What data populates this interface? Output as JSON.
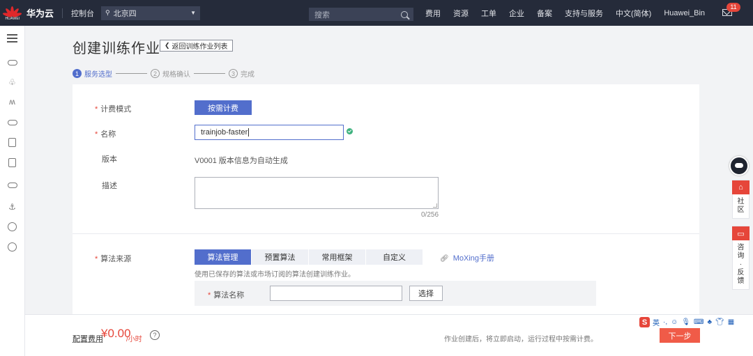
{
  "topbar": {
    "logo_caption": "HUAWEI",
    "brand": "华为云",
    "console": "控制台",
    "region": "北京四",
    "search_placeholder": "搜索",
    "nav": [
      "费用",
      "资源",
      "工单",
      "企业",
      "备案",
      "支持与服务",
      "中文(简体)",
      "Huawei_Bin"
    ],
    "mail_count": "11"
  },
  "page": {
    "title": "创建训练作业",
    "back_label": "返回训练作业列表"
  },
  "steps": [
    {
      "num": "1",
      "label": "服务选型"
    },
    {
      "num": "2",
      "label": "规格确认"
    },
    {
      "num": "3",
      "label": "完成"
    }
  ],
  "form": {
    "billing_label": "计费模式",
    "billing_value": "按需计费",
    "name_label": "名称",
    "name_value": "trainjob-faster",
    "version_label": "版本",
    "version_value": "V0001 版本信息为自动生成",
    "desc_label": "描述",
    "desc_counter": "0/256",
    "algo_source_label": "算法来源",
    "algo_tabs": [
      "算法管理",
      "预置算法",
      "常用框架",
      "自定义"
    ],
    "moxing_link": "MoXing手册",
    "algo_hint": "使用已保存的算法或市场订阅的算法创建训练作业。",
    "algo_name_label": "算法名称",
    "algo_select_button": "选择"
  },
  "float": {
    "community": "社区",
    "feedback": "咨询·反馈"
  },
  "footer": {
    "fee_label": "配置费用",
    "fee_amount": "¥0.00",
    "fee_unit": "/小时",
    "hint": "作业创建后，将立即启动，运行过程中按需计费。",
    "next": "下一步"
  },
  "ime": {
    "logo": "S",
    "lang": "英"
  },
  "colors": {
    "primary": "#526ecc",
    "danger": "#e6463a",
    "topbar": "#252b3a",
    "next_button": "#f05b48"
  }
}
